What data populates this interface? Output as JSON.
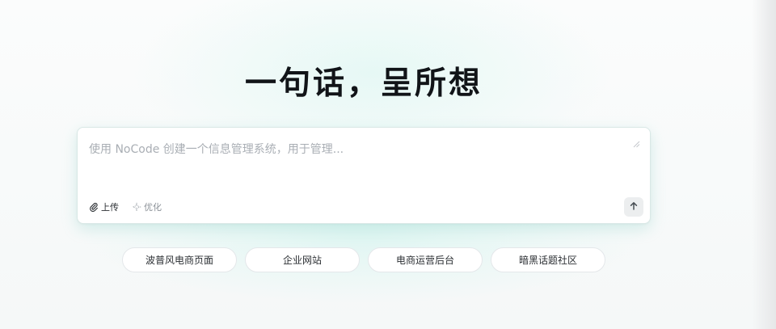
{
  "hero": {
    "title": "一句话，呈所想"
  },
  "composer": {
    "placeholder": "使用 NoCode 创建一个信息管理系统，用于管理...",
    "value": "",
    "upload_label": "上传",
    "upload_icon": "paperclip-icon",
    "optimize_label": "优化",
    "optimize_icon": "sparkle-icon",
    "send_icon": "arrow-up-icon",
    "resize_icon": "resize-handle-icon"
  },
  "suggestions": [
    {
      "label": "波普风电商页面"
    },
    {
      "label": "企业网站"
    },
    {
      "label": "电商运营后台"
    },
    {
      "label": "暗黑话题社区"
    }
  ],
  "colors": {
    "title": "#111418",
    "accent_glow": "#78c8be",
    "placeholder": "#a9aeb4",
    "send_button_bg": "#eceeef"
  }
}
